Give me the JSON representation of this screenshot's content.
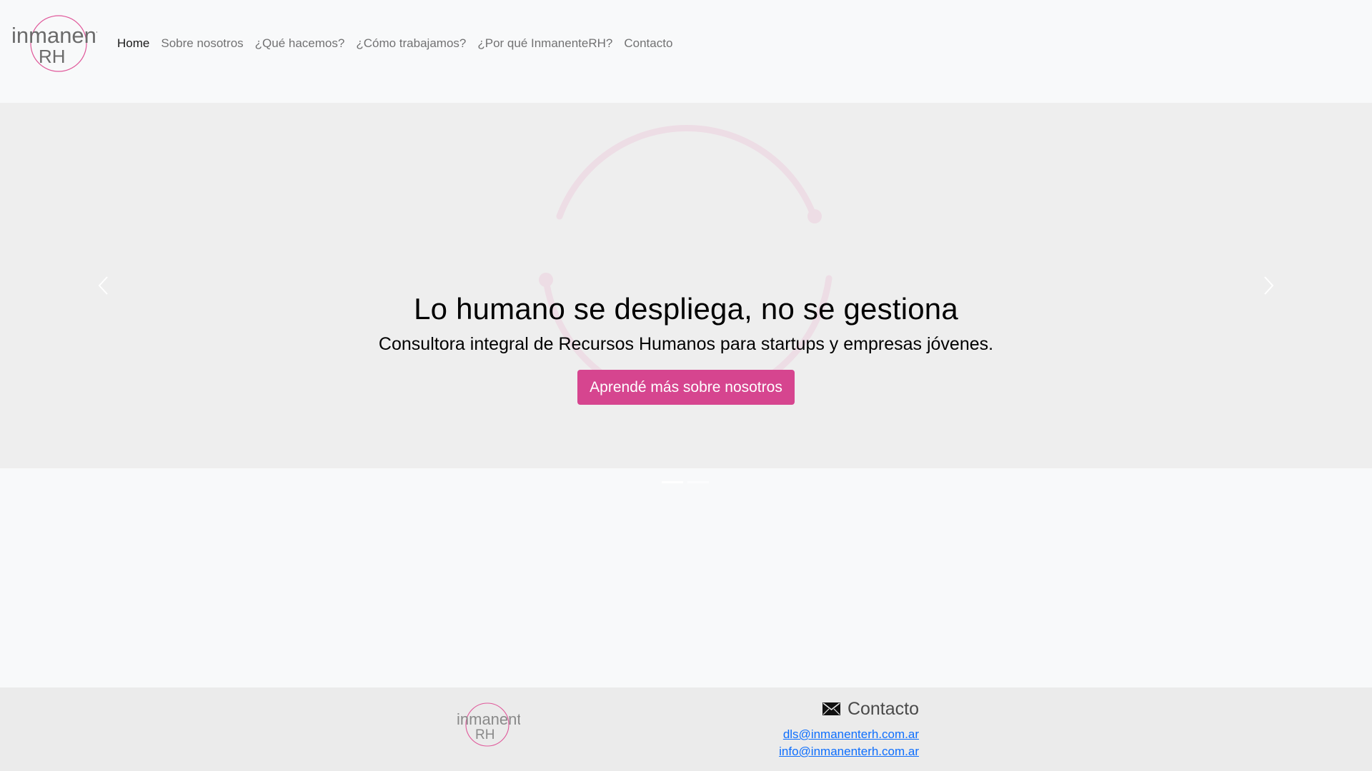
{
  "brand": {
    "logo_line1": "inmanente",
    "logo_line2": "RH"
  },
  "nav": {
    "items": [
      {
        "label": "Home",
        "active": true
      },
      {
        "label": "Sobre nosotros",
        "active": false
      },
      {
        "label": "¿Qué hacemos?",
        "active": false
      },
      {
        "label": "¿Cómo trabajamos?",
        "active": false
      },
      {
        "label": "¿Por qué InmanenteRH?",
        "active": false
      },
      {
        "label": "Contacto",
        "active": false
      }
    ]
  },
  "hero": {
    "title": "Lo humano se despliega, no se gestiona",
    "subtitle": "Consultora integral de Recursos Humanos para startups y empresas jóvenes.",
    "button_label": "Aprendé más sobre nosotros",
    "prev_icon": "chevron-left-icon",
    "next_icon": "chevron-right-icon",
    "indicators": 2,
    "active_indicator": 0
  },
  "footer": {
    "logo_line1": "inmanente",
    "logo_line2": "RH",
    "contact_heading": "Contacto",
    "contact_icon": "envelope-icon",
    "emails": [
      "dls@inmanenterh.com.ar",
      "info@inmanenterh.com.ar"
    ]
  },
  "colors": {
    "accent": "#d6458f",
    "logo_ring": "#e0589a",
    "link": "#0d6efd",
    "hero_bg": "#eeeeee",
    "footer_bg": "#ebebeb"
  }
}
